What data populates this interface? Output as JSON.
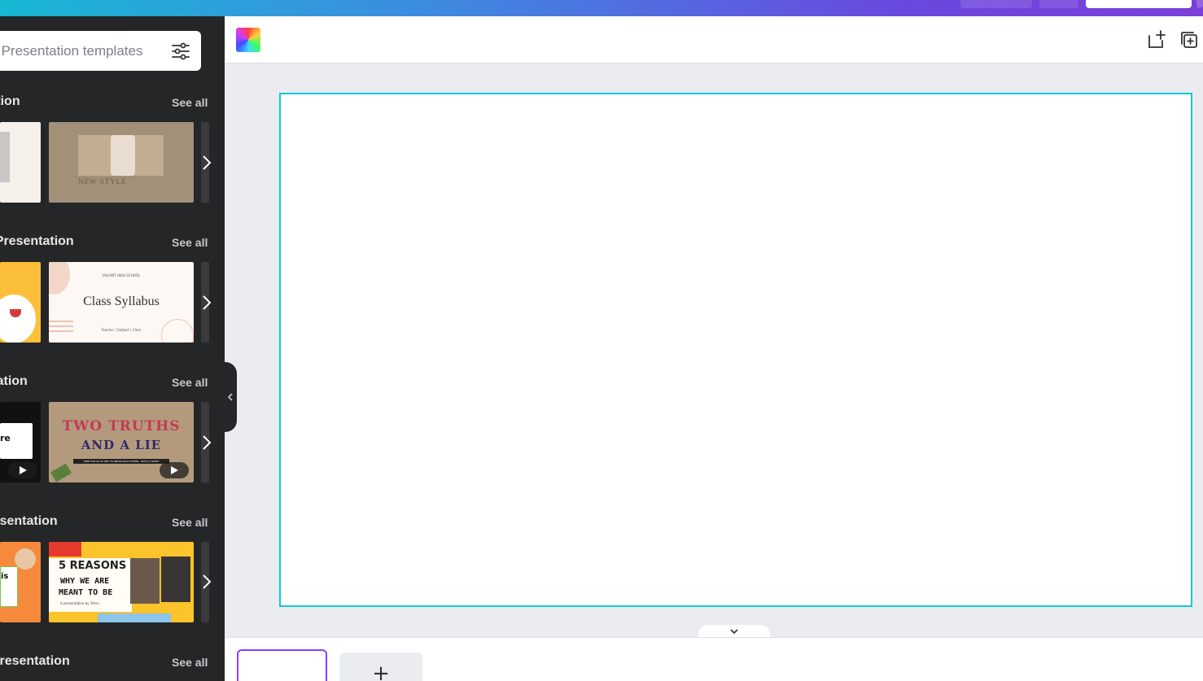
{
  "search": {
    "placeholder": "Search Presentation templates"
  },
  "sections": [
    {
      "title": "Minimalist Presentation",
      "see_all": "See all"
    },
    {
      "title": "Education Presentation",
      "see_all": "See all"
    },
    {
      "title": "Game Presentation",
      "see_all": "See all"
    },
    {
      "title": "Fashion Presentation",
      "see_all": "See all"
    },
    {
      "title": "Brainstorm Presentation",
      "see_all": "See all"
    }
  ],
  "templates": {
    "new_style": {
      "title": "NEW STYLE"
    },
    "class_syllabus": {
      "school": "VALIANT HIGH SCHOOL",
      "title": "Class Syllabus",
      "teacher": "Teacher | Subject | Class"
    },
    "two_truths": {
      "line1": "TWO TRUTHS",
      "line2": "AND A LIE",
      "sub": "TIME FOR US TO GET TO KNOW EACH OTHER - WITH A TWIST!"
    },
    "five_reasons": {
      "line1": "5 REASONS",
      "line2": "WHY WE ARE",
      "line3": "MEANT TO BE",
      "sub": "A presentation by Tohru"
    },
    "game_left": {
      "text": "re"
    },
    "fashion_left": {
      "text": "is"
    }
  },
  "editor": {
    "add_page_label": "+"
  },
  "colors": {
    "accent": "#8b3dff",
    "canvas_border": "#14c8dc",
    "panel_bg": "#252627"
  }
}
